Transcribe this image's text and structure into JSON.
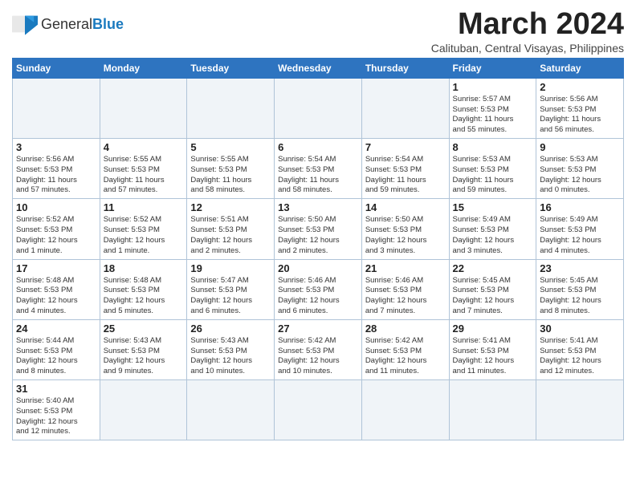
{
  "header": {
    "month_year": "March 2024",
    "location": "Calituban, Central Visayas, Philippines"
  },
  "logo": {
    "line1": "General",
    "line2": "Blue"
  },
  "days_of_week": [
    "Sunday",
    "Monday",
    "Tuesday",
    "Wednesday",
    "Thursday",
    "Friday",
    "Saturday"
  ],
  "weeks": [
    [
      {
        "day": "",
        "info": ""
      },
      {
        "day": "",
        "info": ""
      },
      {
        "day": "",
        "info": ""
      },
      {
        "day": "",
        "info": ""
      },
      {
        "day": "",
        "info": ""
      },
      {
        "day": "1",
        "info": "Sunrise: 5:57 AM\nSunset: 5:53 PM\nDaylight: 11 hours\nand 55 minutes."
      },
      {
        "day": "2",
        "info": "Sunrise: 5:56 AM\nSunset: 5:53 PM\nDaylight: 11 hours\nand 56 minutes."
      }
    ],
    [
      {
        "day": "3",
        "info": "Sunrise: 5:56 AM\nSunset: 5:53 PM\nDaylight: 11 hours\nand 57 minutes."
      },
      {
        "day": "4",
        "info": "Sunrise: 5:55 AM\nSunset: 5:53 PM\nDaylight: 11 hours\nand 57 minutes."
      },
      {
        "day": "5",
        "info": "Sunrise: 5:55 AM\nSunset: 5:53 PM\nDaylight: 11 hours\nand 58 minutes."
      },
      {
        "day": "6",
        "info": "Sunrise: 5:54 AM\nSunset: 5:53 PM\nDaylight: 11 hours\nand 58 minutes."
      },
      {
        "day": "7",
        "info": "Sunrise: 5:54 AM\nSunset: 5:53 PM\nDaylight: 11 hours\nand 59 minutes."
      },
      {
        "day": "8",
        "info": "Sunrise: 5:53 AM\nSunset: 5:53 PM\nDaylight: 11 hours\nand 59 minutes."
      },
      {
        "day": "9",
        "info": "Sunrise: 5:53 AM\nSunset: 5:53 PM\nDaylight: 12 hours\nand 0 minutes."
      }
    ],
    [
      {
        "day": "10",
        "info": "Sunrise: 5:52 AM\nSunset: 5:53 PM\nDaylight: 12 hours\nand 1 minute."
      },
      {
        "day": "11",
        "info": "Sunrise: 5:52 AM\nSunset: 5:53 PM\nDaylight: 12 hours\nand 1 minute."
      },
      {
        "day": "12",
        "info": "Sunrise: 5:51 AM\nSunset: 5:53 PM\nDaylight: 12 hours\nand 2 minutes."
      },
      {
        "day": "13",
        "info": "Sunrise: 5:50 AM\nSunset: 5:53 PM\nDaylight: 12 hours\nand 2 minutes."
      },
      {
        "day": "14",
        "info": "Sunrise: 5:50 AM\nSunset: 5:53 PM\nDaylight: 12 hours\nand 3 minutes."
      },
      {
        "day": "15",
        "info": "Sunrise: 5:49 AM\nSunset: 5:53 PM\nDaylight: 12 hours\nand 3 minutes."
      },
      {
        "day": "16",
        "info": "Sunrise: 5:49 AM\nSunset: 5:53 PM\nDaylight: 12 hours\nand 4 minutes."
      }
    ],
    [
      {
        "day": "17",
        "info": "Sunrise: 5:48 AM\nSunset: 5:53 PM\nDaylight: 12 hours\nand 4 minutes."
      },
      {
        "day": "18",
        "info": "Sunrise: 5:48 AM\nSunset: 5:53 PM\nDaylight: 12 hours\nand 5 minutes."
      },
      {
        "day": "19",
        "info": "Sunrise: 5:47 AM\nSunset: 5:53 PM\nDaylight: 12 hours\nand 6 minutes."
      },
      {
        "day": "20",
        "info": "Sunrise: 5:46 AM\nSunset: 5:53 PM\nDaylight: 12 hours\nand 6 minutes."
      },
      {
        "day": "21",
        "info": "Sunrise: 5:46 AM\nSunset: 5:53 PM\nDaylight: 12 hours\nand 7 minutes."
      },
      {
        "day": "22",
        "info": "Sunrise: 5:45 AM\nSunset: 5:53 PM\nDaylight: 12 hours\nand 7 minutes."
      },
      {
        "day": "23",
        "info": "Sunrise: 5:45 AM\nSunset: 5:53 PM\nDaylight: 12 hours\nand 8 minutes."
      }
    ],
    [
      {
        "day": "24",
        "info": "Sunrise: 5:44 AM\nSunset: 5:53 PM\nDaylight: 12 hours\nand 8 minutes."
      },
      {
        "day": "25",
        "info": "Sunrise: 5:43 AM\nSunset: 5:53 PM\nDaylight: 12 hours\nand 9 minutes."
      },
      {
        "day": "26",
        "info": "Sunrise: 5:43 AM\nSunset: 5:53 PM\nDaylight: 12 hours\nand 10 minutes."
      },
      {
        "day": "27",
        "info": "Sunrise: 5:42 AM\nSunset: 5:53 PM\nDaylight: 12 hours\nand 10 minutes."
      },
      {
        "day": "28",
        "info": "Sunrise: 5:42 AM\nSunset: 5:53 PM\nDaylight: 12 hours\nand 11 minutes."
      },
      {
        "day": "29",
        "info": "Sunrise: 5:41 AM\nSunset: 5:53 PM\nDaylight: 12 hours\nand 11 minutes."
      },
      {
        "day": "30",
        "info": "Sunrise: 5:41 AM\nSunset: 5:53 PM\nDaylight: 12 hours\nand 12 minutes."
      }
    ],
    [
      {
        "day": "31",
        "info": "Sunrise: 5:40 AM\nSunset: 5:53 PM\nDaylight: 12 hours\nand 12 minutes."
      },
      {
        "day": "",
        "info": ""
      },
      {
        "day": "",
        "info": ""
      },
      {
        "day": "",
        "info": ""
      },
      {
        "day": "",
        "info": ""
      },
      {
        "day": "",
        "info": ""
      },
      {
        "day": "",
        "info": ""
      }
    ]
  ]
}
